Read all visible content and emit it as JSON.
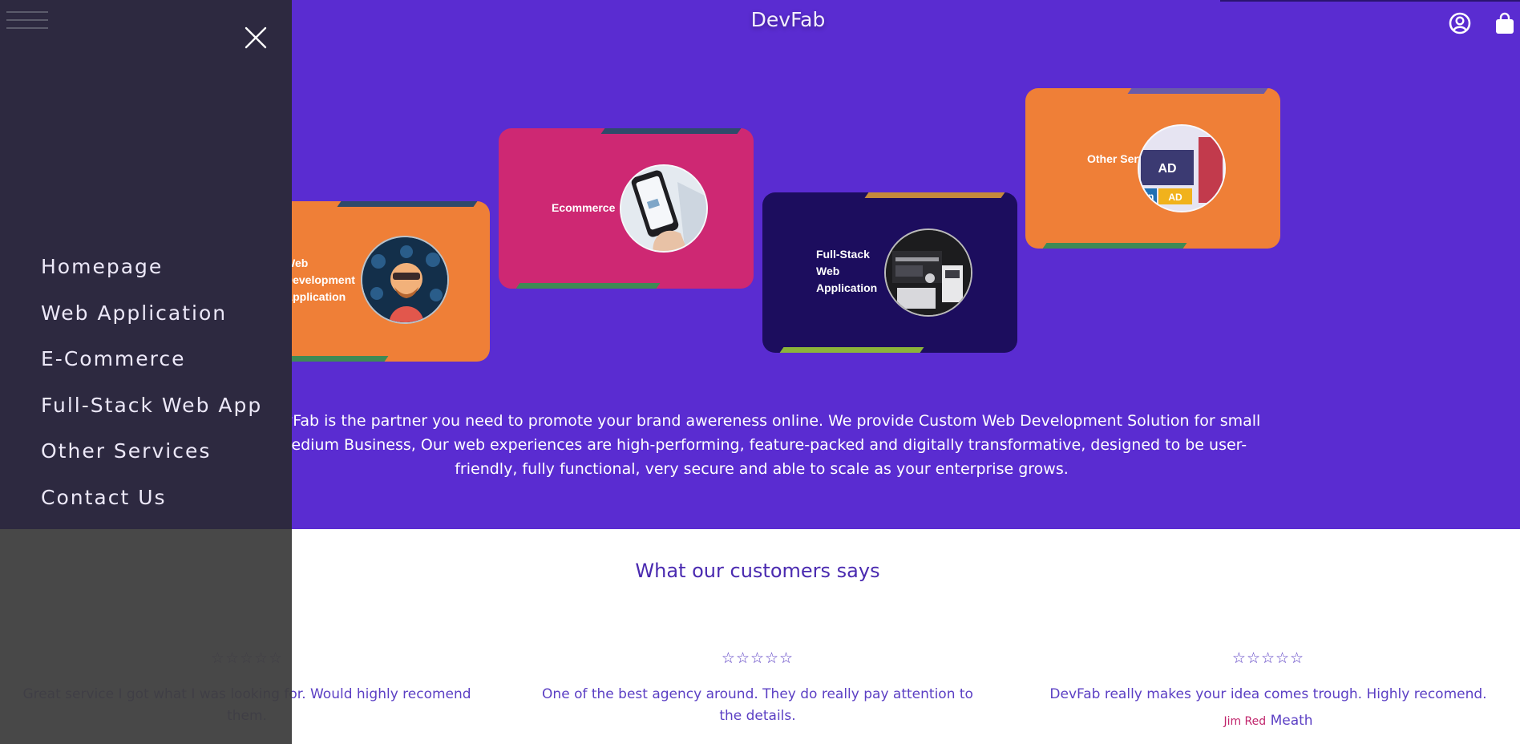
{
  "brand": {
    "name": "DevFab"
  },
  "header": {
    "icons": [
      "user-circle-icon",
      "shopping-bag-icon"
    ]
  },
  "colors": {
    "hero_bg": "#5a2cd1",
    "menu_bg": "#2d2940",
    "orange": "#ef7f37",
    "pink": "#ce2873",
    "navy": "#1c0d5e",
    "accent_text": "#5b3fc4"
  },
  "services": [
    {
      "label": "Web Development Application"
    },
    {
      "label": "Ecommerce"
    },
    {
      "label": "Full-Stack Web Application"
    },
    {
      "label": "Other Services"
    }
  ],
  "about": {
    "text": "DevFab is the partner you need to promote your brand awereness online. We provide Custom Web Development Solution for small medium Business, Our web experiences are high-performing, feature-packed and digitally transformative, designed to be user-friendly, fully functional, very secure and able to scale as your enterprise grows."
  },
  "testimonials": {
    "title": "What our customers says",
    "reviews": [
      {
        "stars": "☆☆☆☆☆",
        "rating": 0,
        "text": "Great service I got what I was looking for. Would highly recomend them."
      },
      {
        "stars": "☆☆☆☆☆",
        "rating": 0,
        "text": "One of the best agency around. They do really pay attention to the details."
      },
      {
        "stars": "☆☆☆☆☆",
        "rating": 0,
        "text": "DevFab really makes your idea comes trough. Highly recomend.",
        "author_first": "Jim Red",
        "author_last": "Meath"
      }
    ]
  },
  "menu": {
    "items": [
      {
        "label": "Homepage"
      },
      {
        "label": "Web Application"
      },
      {
        "label": "E-Commerce"
      },
      {
        "label": "Full-Stack Web App"
      },
      {
        "label": "Other Services"
      },
      {
        "label": "Contact Us"
      }
    ]
  }
}
